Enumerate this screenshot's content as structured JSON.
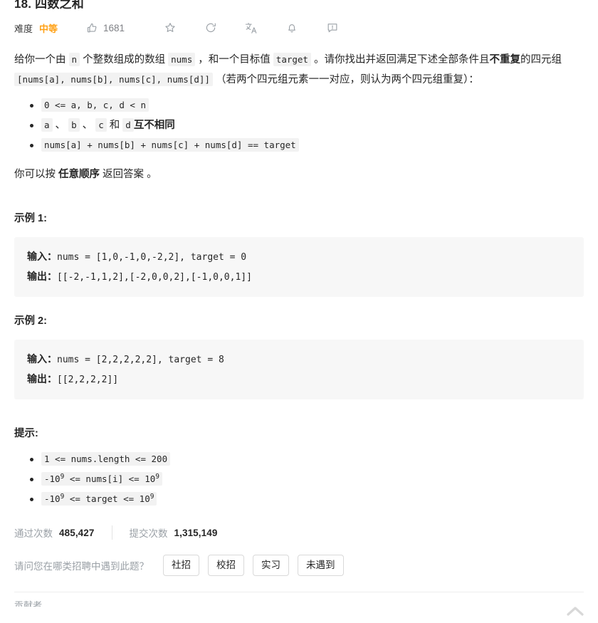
{
  "header": {
    "title": "18. 四数之和",
    "difficulty_label": "难度",
    "difficulty_value": "中等",
    "like_count": "1681",
    "accent_color": "#ffa116",
    "icons": [
      {
        "name": "thumbs-up-icon"
      },
      {
        "name": "star-icon"
      },
      {
        "name": "share-icon"
      },
      {
        "name": "translate-icon"
      },
      {
        "name": "bell-icon"
      },
      {
        "name": "report-icon"
      }
    ]
  },
  "description": {
    "p1_a": "给你一个由 ",
    "p1_code_n": "n",
    "p1_b": " 个整数组成的数组 ",
    "p1_code_nums": "nums",
    "p1_c": " ，和一个目标值 ",
    "p1_code_target": "target",
    "p1_d": " 。请你找出并返回满足下述全部条件且",
    "p1_bold": "不重复",
    "p1_e": "的四元组 ",
    "p1_code_quad": "[nums[a], nums[b], nums[c], nums[d]]",
    "p1_f": " （若两个四元组元素一一对应，则认为两个四元组重复）：",
    "constraints": [
      {
        "code": "0 <= a, b, c, d < n",
        "suffix": "",
        "bold": ""
      },
      {
        "code_parts": [
          "a",
          "b",
          "c",
          "d"
        ],
        "text_join1": " 、 ",
        "text_and": " 和 ",
        "bold": "互不相同"
      },
      {
        "code": "nums[a] + nums[b] + nums[c] + nums[d] == target",
        "suffix": "",
        "bold": ""
      }
    ],
    "p2_a": "你可以按 ",
    "p2_bold": "任意顺序",
    "p2_b": " 返回答案 。"
  },
  "examples": [
    {
      "heading": "示例 1:",
      "input_label": "输入：",
      "input_value": "nums = [1,0,-1,0,-2,2], target = 0",
      "output_label": "输出：",
      "output_value": "[[-2,-1,1,2],[-2,0,0,2],[-1,0,0,1]]"
    },
    {
      "heading": "示例 2:",
      "input_label": "输入：",
      "input_value": "nums = [2,2,2,2,2], target = 8",
      "output_label": "输出：",
      "output_value": "[[2,2,2,2]]"
    }
  ],
  "hints": {
    "heading": "提示:",
    "items": [
      {
        "pre": "1 <= nums.length <= 200",
        "sup1": "",
        "mid": "",
        "sup2": "",
        "post": ""
      },
      {
        "pre": "-10",
        "sup1": "9",
        "mid": " <= nums[i] <= 10",
        "sup2": "9",
        "post": ""
      },
      {
        "pre": "-10",
        "sup1": "9",
        "mid": " <= target <= 10",
        "sup2": "9",
        "post": ""
      }
    ]
  },
  "stats": {
    "passed_label": "通过次数",
    "passed_value": "485,427",
    "submitted_label": "提交次数",
    "submitted_value": "1,315,149"
  },
  "survey": {
    "question": "请问您在哪类招聘中遇到此题？",
    "options": [
      "社招",
      "校招",
      "实习",
      "未遇到"
    ]
  },
  "footer": {
    "clipped_text": "贡献者",
    "back_to_top_icon": "chevron-up-icon"
  }
}
